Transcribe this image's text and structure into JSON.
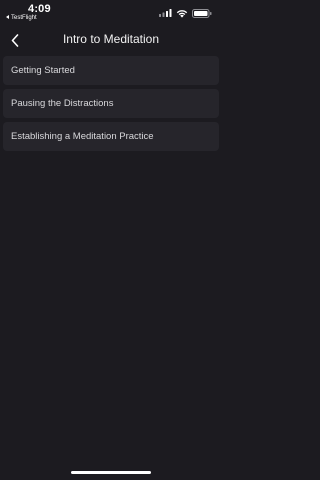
{
  "status_bar": {
    "time": "4:09",
    "back_app_label": "TestFlight",
    "icons": [
      "cellular-signal-icon",
      "wifi-icon",
      "battery-icon"
    ]
  },
  "nav": {
    "title": "Intro to Meditation",
    "back_icon": "chevron-left-icon"
  },
  "lessons": [
    {
      "label": "Getting Started"
    },
    {
      "label": "Pausing the Distractions"
    },
    {
      "label": "Establishing a Meditation Practice"
    }
  ],
  "colors": {
    "background": "#1c1b20",
    "card": "#26252b",
    "text": "#ffffff"
  }
}
